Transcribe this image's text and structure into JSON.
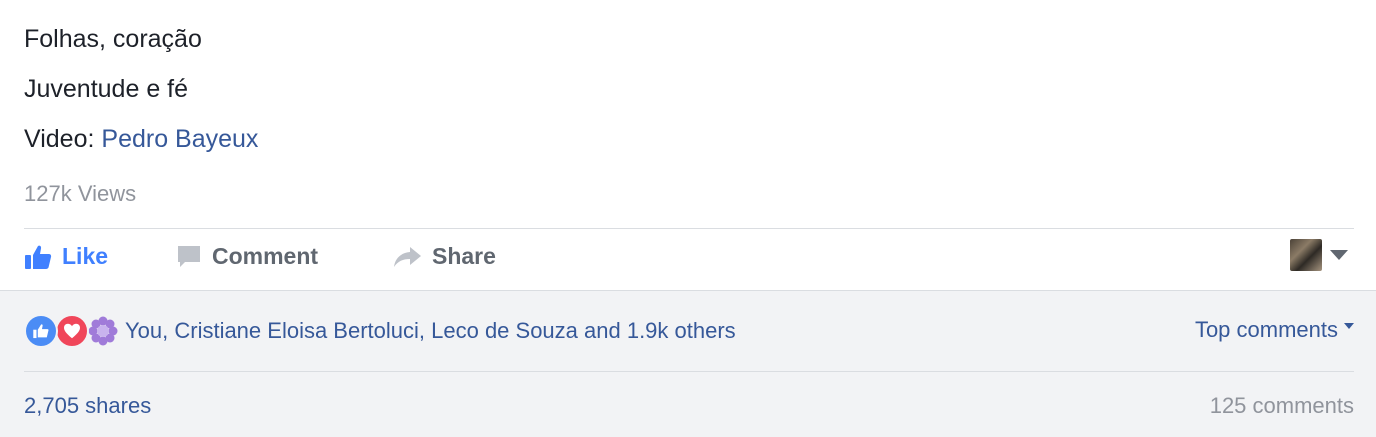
{
  "post": {
    "line1": "Folhas, coração",
    "line2": "Juventude e fé",
    "video_label": "Video: ",
    "video_author": "Pedro Bayeux",
    "views": "127k Views"
  },
  "actions": {
    "like": "Like",
    "comment": "Comment",
    "share": "Share",
    "like_color": "#4080ff",
    "icon_color": "#606770"
  },
  "reactions": {
    "icons": [
      "like-icon",
      "love-icon",
      "flower-icon"
    ],
    "summary": "You, Cristiane Eloisa Bertoluci, Leco de Souza and 1.9k others",
    "sort_label": "Top comments"
  },
  "stats": {
    "shares": "2,705 shares",
    "comments": "125 comments"
  },
  "colors": {
    "link": "#365899",
    "muted": "#90949c",
    "feedback_bg": "#f2f3f5",
    "love": "#f0465a",
    "like": "#4b8cf5"
  }
}
